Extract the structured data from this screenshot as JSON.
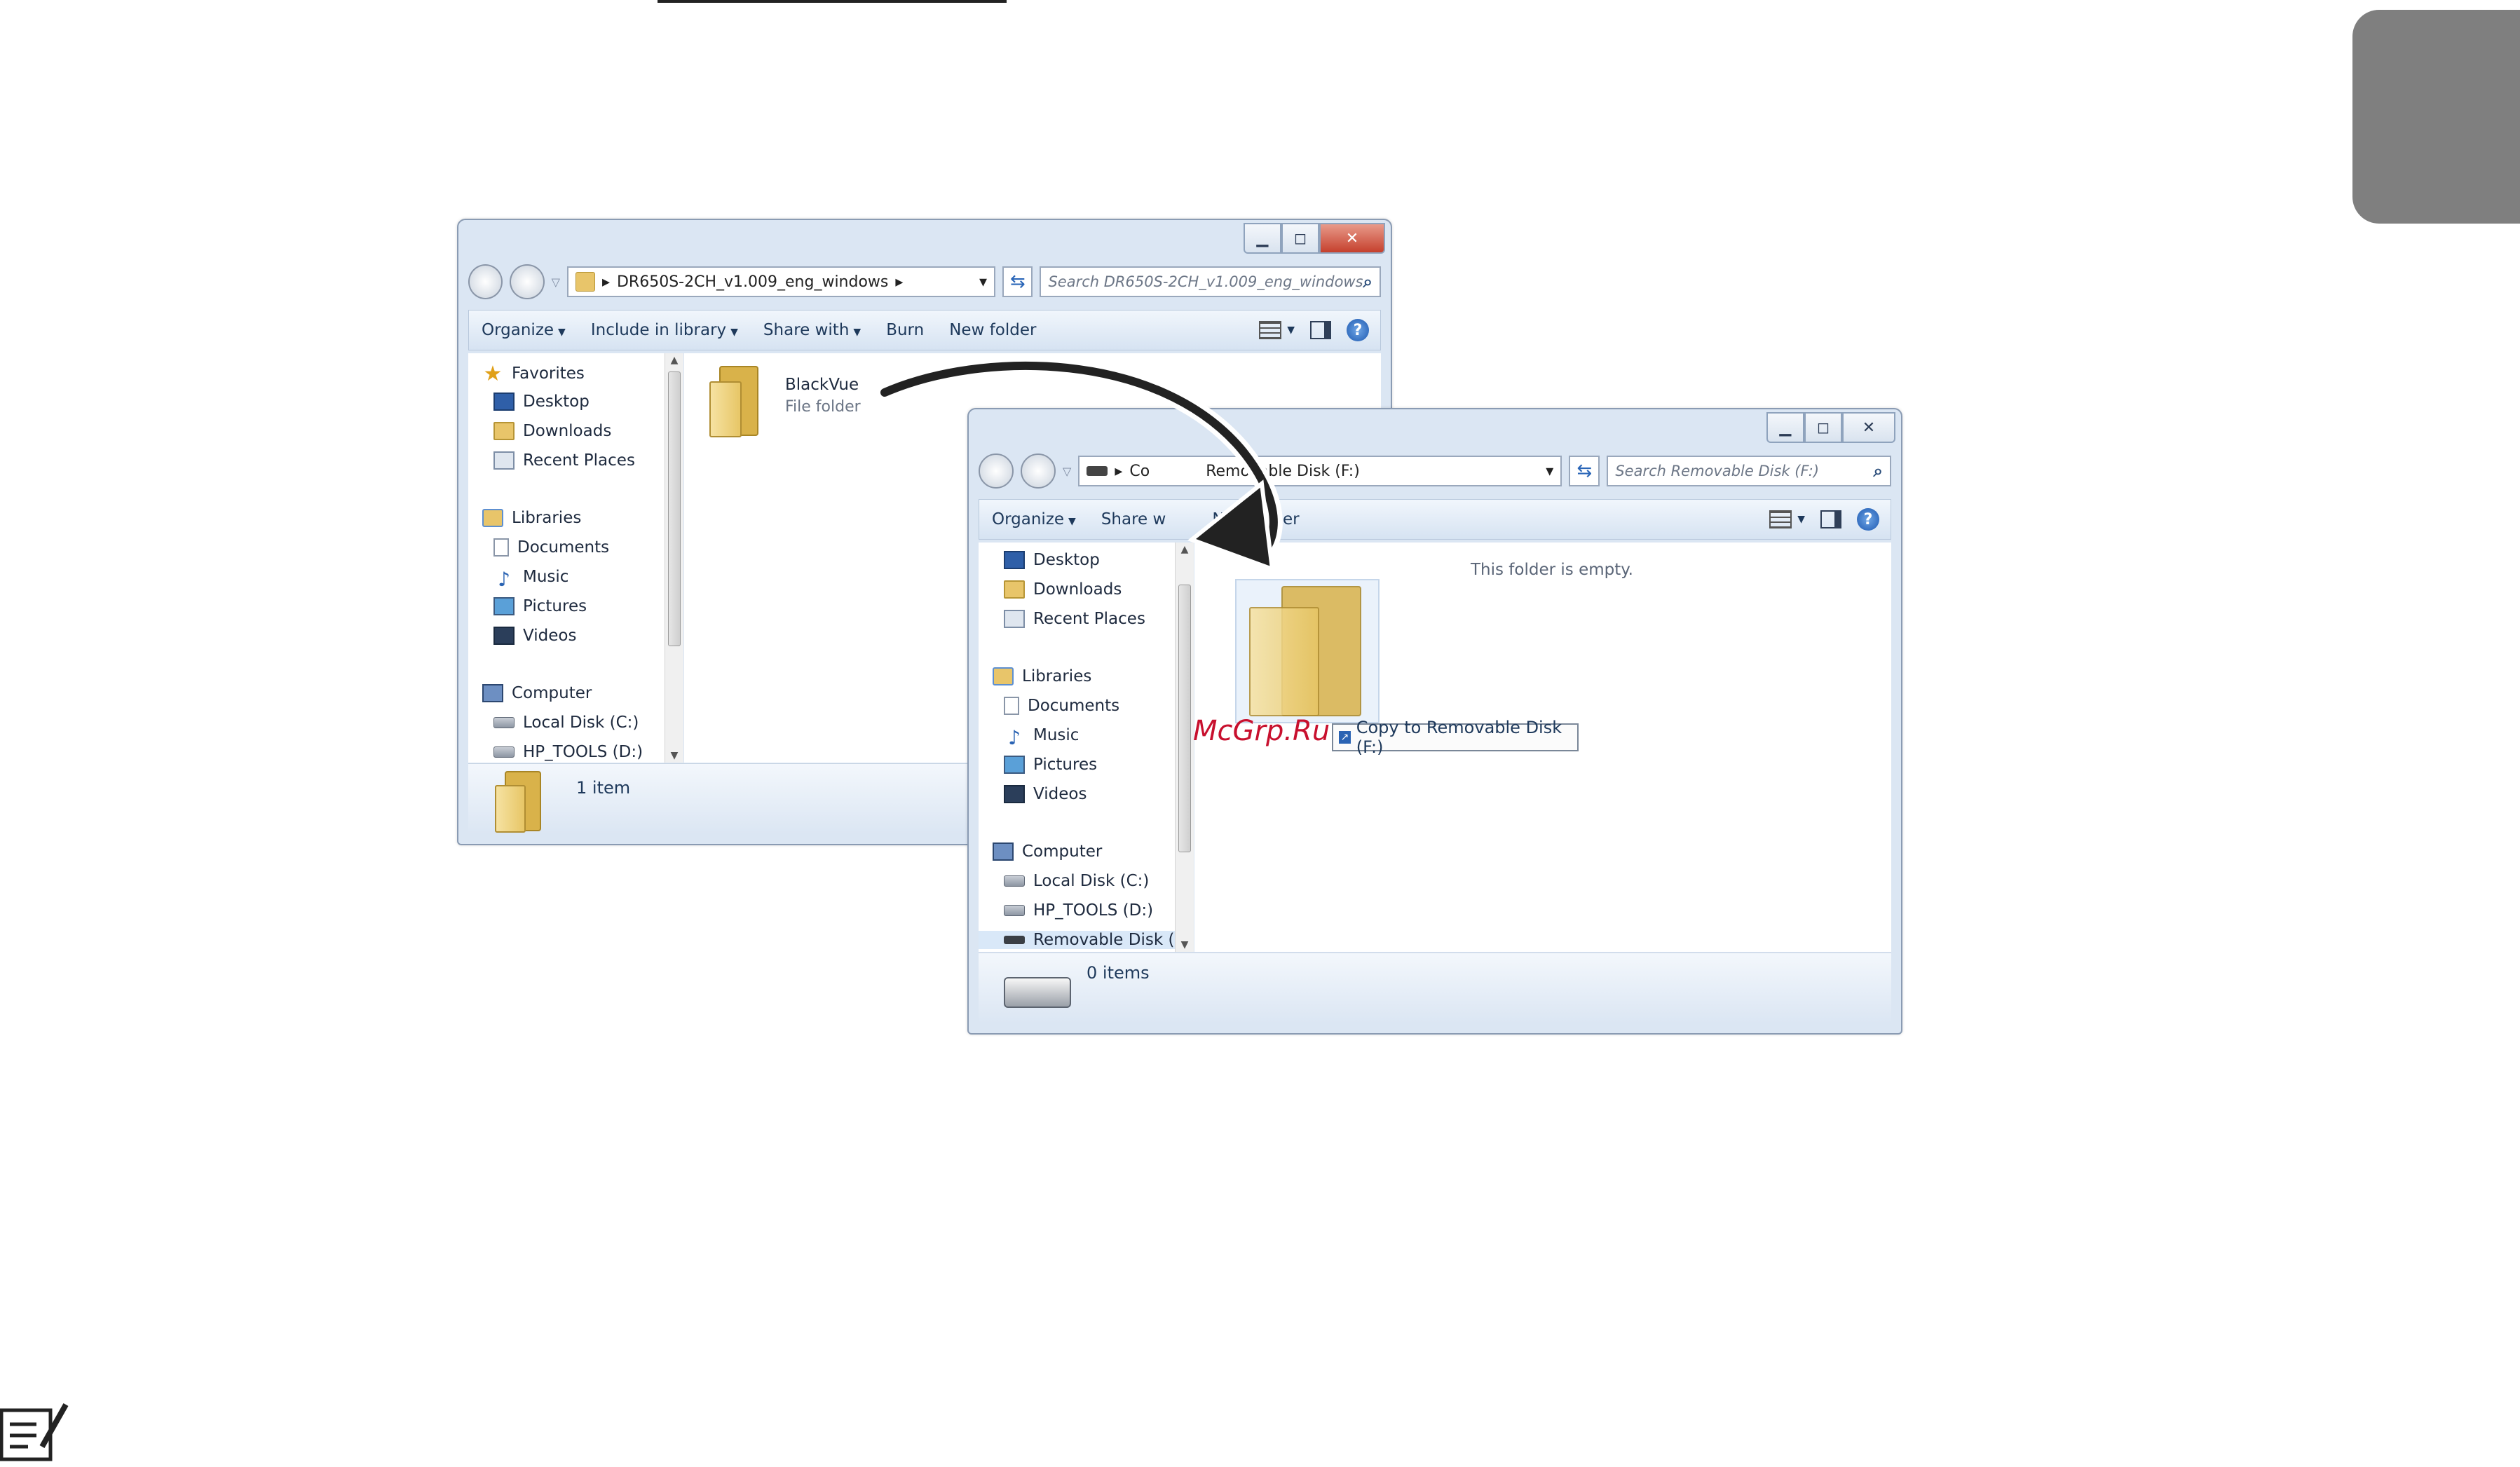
{
  "window1": {
    "address_path": "DR650S-2CH_v1.009_eng_windows",
    "search_placeholder": "Search DR650S-2CH_v1.009_eng_windows",
    "toolbar": {
      "organize": "Organize",
      "include_in_library": "Include in library",
      "share_with": "Share with",
      "burn": "Burn",
      "new_folder": "New folder"
    },
    "nav": {
      "favorites": "Favorites",
      "desktop": "Desktop",
      "downloads": "Downloads",
      "recent_places": "Recent Places",
      "libraries": "Libraries",
      "documents": "Documents",
      "music": "Music",
      "pictures": "Pictures",
      "videos": "Videos",
      "computer": "Computer",
      "local_disk": "Local Disk (C:)",
      "hp_tools": "HP_TOOLS (D:)"
    },
    "file": {
      "name": "BlackVue",
      "type": "File folder"
    },
    "status": "1 item"
  },
  "window2": {
    "address_prefix": "Co",
    "address_path": "Removable Disk (F:)",
    "search_placeholder": "Search Removable Disk (F:)",
    "toolbar": {
      "organize": "Organize",
      "share_with": "Share w",
      "new_folder": "New folder"
    },
    "nav": {
      "desktop": "Desktop",
      "downloads": "Downloads",
      "recent_places": "Recent Places",
      "libraries": "Libraries",
      "documents": "Documents",
      "music": "Music",
      "pictures": "Pictures",
      "videos": "Videos",
      "computer": "Computer",
      "local_disk": "Local Disk (C:)",
      "hp_tools": "HP_TOOLS (D:)",
      "removable_disk": "Removable Disk ("
    },
    "empty_text": "This folder is empty.",
    "status": "0 items"
  },
  "drag_tooltip": "Copy to Removable Disk (F:)",
  "watermark": "McGrp.Ru",
  "icons": {
    "search": "search-icon",
    "help": "help-icon",
    "back": "back-icon",
    "forward": "forward-icon",
    "refresh": "refresh-icon"
  }
}
